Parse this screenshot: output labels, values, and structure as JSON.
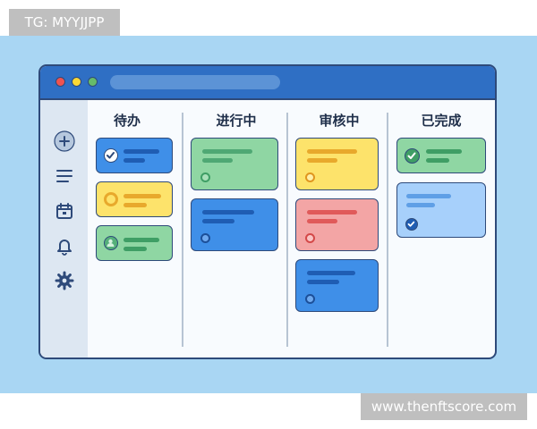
{
  "watermark": {
    "top_text": "TG: MYYJJPP",
    "bottom_text": "www.thenftscore.com"
  },
  "sidebar": {
    "items": [
      {
        "icon": "plus-icon"
      },
      {
        "icon": "menu-icon"
      },
      {
        "icon": "calendar-icon"
      },
      {
        "icon": "bell-icon"
      },
      {
        "icon": "gear-icon"
      }
    ]
  },
  "board": {
    "columns": [
      {
        "title": "待办"
      },
      {
        "title": "进行中"
      },
      {
        "title": "审核中"
      },
      {
        "title": "已完成"
      }
    ]
  },
  "colors": {
    "titlebar": "#2f6fc4",
    "backdrop": "#a9d6f3",
    "card_blue": "#3f8fe8",
    "card_yellow": "#fde36b",
    "card_green": "#8fd6a3",
    "card_red": "#f3a5a5",
    "card_lightblue": "#a7d0fb"
  }
}
